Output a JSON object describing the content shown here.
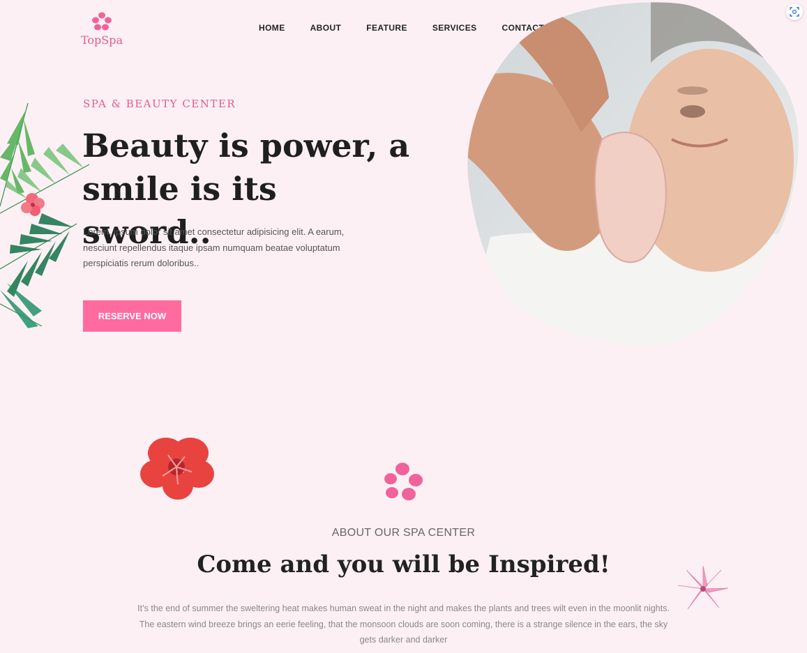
{
  "brand": {
    "name": "TopSpa",
    "accent": "#ff6a9f",
    "accent_text": "#e45a8a",
    "background": "#fdf0f5",
    "logo_icon": "flower-petals-icon"
  },
  "nav": {
    "items": [
      "HOME",
      "ABOUT",
      "FEATURE",
      "SERVICES",
      "CONTACT"
    ]
  },
  "toolbar": {
    "screenshot_icon": "screenshot-capture-icon"
  },
  "hero": {
    "eyebrow": "SPA & BEAUTY CENTER",
    "title": "Beauty is power, a smile is its sword..",
    "text": "Lorem, ipsum dolor sit amet consectetur adipisicing elit. A earum, nesciunt repellendus itaque ipsam numquam beatae voluptatum perspiciatis rerum doloribus..",
    "cta": "RESERVE NOW",
    "image_icon": "facial-massage-photo"
  },
  "about": {
    "subtitle": "ABOUT OUR SPA CENTER",
    "title": "Come and you will be Inspired!",
    "text": "It’s the end of summer the sweltering heat makes human sweat in the night and makes the plants and trees wilt even in the moonlit nights. The eastern wind breeze brings an eerie feeling, that the monsoon clouds are soon coming, there is a strange silence in the ears, the sky gets darker and darker"
  }
}
